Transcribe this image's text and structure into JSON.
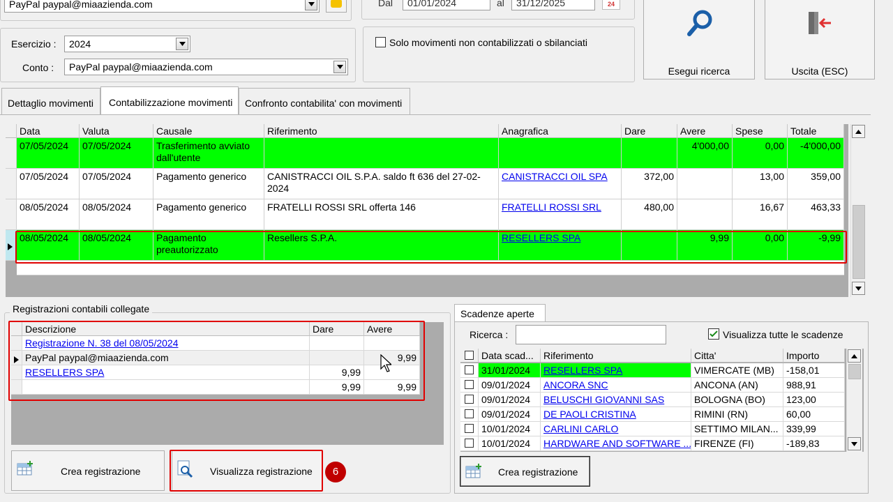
{
  "top": {
    "account_combo_top": "PayPal paypal@miaazienda.com",
    "dal_label": "Dal",
    "dal_value": "01/01/2024",
    "al_label": "al",
    "al_value": "31/12/2025",
    "calendar_badge": "24",
    "esercizio_label": "Esercizio :",
    "esercizio_value": "2024",
    "conto_label": "Conto :",
    "conto_value": "PayPal paypal@miaazienda.com",
    "solo_label": "Solo movimenti non contabilizzati o sbilanciati",
    "search_button": "Esegui ricerca",
    "exit_button": "Uscita (ESC)"
  },
  "tabs": [
    "Dettaglio movimenti",
    "Contabilizzazione movimenti",
    "Confronto contabilita' con movimenti"
  ],
  "movements": {
    "columns": [
      "Data",
      "Valuta",
      "Causale",
      "Riferimento",
      "Anagrafica",
      "Dare",
      "Avere",
      "Spese",
      "Totale"
    ],
    "rows": [
      {
        "data": "07/05/2024",
        "valuta": "07/05/2024",
        "causale": "Trasferimento avviato dall'utente",
        "riferimento": "",
        "anagrafica": "",
        "dare": "",
        "avere": "4'000,00",
        "spese": "0,00",
        "totale": "-4'000,00",
        "highlight": true,
        "current": false
      },
      {
        "data": "07/05/2024",
        "valuta": "07/05/2024",
        "causale": "Pagamento generico",
        "riferimento": "CANISTRACCI OIL S.P.A. saldo ft 636 del 27-02-2024",
        "anagrafica": "CANISTRACCI OIL SPA",
        "dare": "372,00",
        "avere": "",
        "spese": "13,00",
        "totale": "359,00",
        "highlight": false,
        "current": false
      },
      {
        "data": "08/05/2024",
        "valuta": "08/05/2024",
        "causale": "Pagamento generico",
        "riferimento": "FRATELLI ROSSI SRL offerta 146",
        "anagrafica": "FRATELLI ROSSI SRL",
        "dare": "480,00",
        "avere": "",
        "spese": "16,67",
        "totale": "463,33",
        "highlight": false,
        "current": false
      },
      {
        "data": "08/05/2024",
        "valuta": "08/05/2024",
        "causale": "Pagamento preautorizzato",
        "riferimento": "Resellers S.P.A.",
        "anagrafica": "RESELLERS SPA",
        "dare": "",
        "avere": "9,99",
        "spese": "0,00",
        "totale": "-9,99",
        "highlight": true,
        "current": true
      }
    ]
  },
  "registrazioni": {
    "title": "Registrazioni contabili collegate",
    "columns": [
      "Descrizione",
      "Dare",
      "Avere"
    ],
    "rows": [
      {
        "descrizione": "Registrazione N. 38 del 08/05/2024",
        "dare": "",
        "avere": "",
        "link": true
      },
      {
        "descrizione": "PayPal paypal@miaazienda.com",
        "dare": "",
        "avere": "9,99",
        "link": false
      },
      {
        "descrizione": "RESELLERS SPA",
        "dare": "9,99",
        "avere": "",
        "link": true
      },
      {
        "descrizione": "",
        "dare": "9,99",
        "avere": "9,99",
        "link": false
      }
    ],
    "create_button": "Crea registrazione",
    "view_button": "Visualizza registrazione",
    "step_badge": "6"
  },
  "scadenze": {
    "tab": "Scadenze aperte",
    "ricerca_label": "Ricerca :",
    "ricerca_value": "",
    "show_all_label": "Visualizza tutte le scadenze",
    "columns": [
      "Data scad...",
      "Riferimento",
      "Citta'",
      "Importo"
    ],
    "rows": [
      {
        "data": "31/01/2024",
        "riferimento": "RESELLERS SPA",
        "citta": "VIMERCATE (MB)",
        "importo": "-158,01",
        "highlight": true
      },
      {
        "data": "09/01/2024",
        "riferimento": "ANCORA SNC",
        "citta": "ANCONA (AN)",
        "importo": "988,91",
        "highlight": false
      },
      {
        "data": "09/01/2024",
        "riferimento": "BELUSCHI GIOVANNI SAS",
        "citta": "BOLOGNA (BO)",
        "importo": "123,00",
        "highlight": false
      },
      {
        "data": "09/01/2024",
        "riferimento": "DE PAOLI CRISTINA",
        "citta": "RIMINI (RN)",
        "importo": "60,00",
        "highlight": false
      },
      {
        "data": "10/01/2024",
        "riferimento": "CARLINI CARLO",
        "citta": "SETTIMO MILAN...",
        "importo": "339,99",
        "highlight": false
      },
      {
        "data": "10/01/2024",
        "riferimento": "HARDWARE AND SOFTWARE ...",
        "citta": "FIRENZE (FI)",
        "importo": "-189,83",
        "highlight": false
      }
    ],
    "create_button": "Crea registrazione"
  },
  "colors": {
    "highlight": "#00ff00",
    "red_box": "#e00000",
    "link": "#0000ee",
    "badge": "#c00000"
  }
}
